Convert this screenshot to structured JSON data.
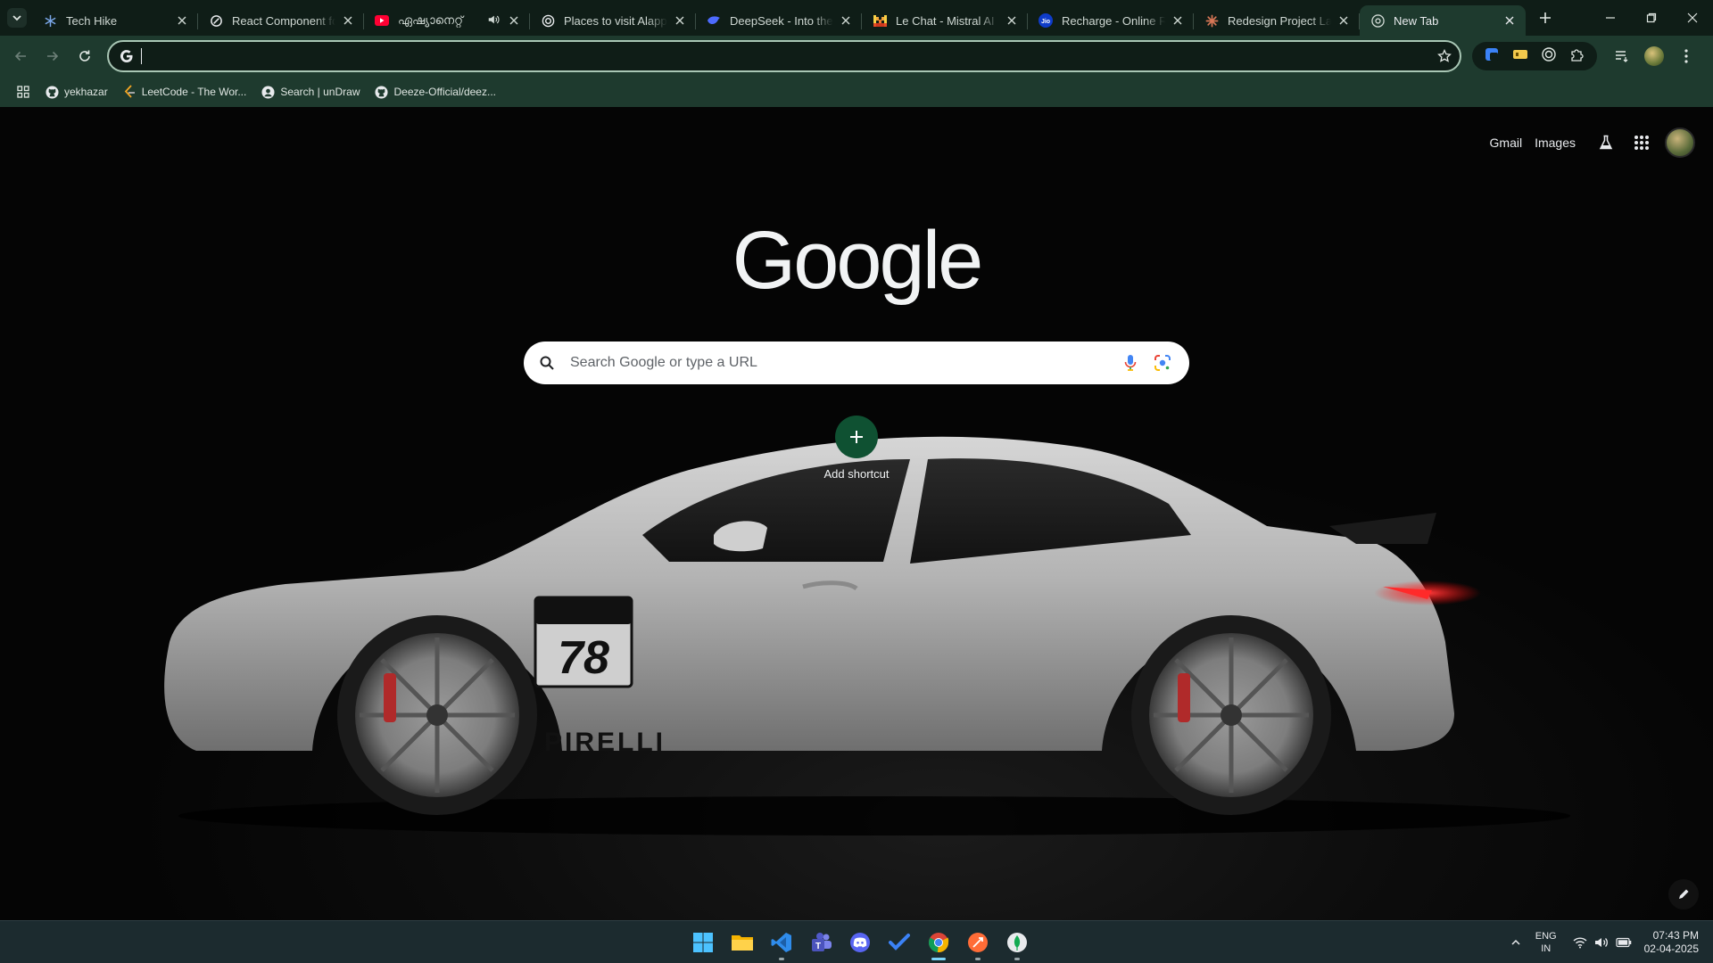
{
  "colors": {
    "accent": "#0f5132",
    "frame": "#1e3a2e",
    "tabstrip": "#0f1d17"
  },
  "tabs": [
    {
      "title": "Tech Hike",
      "icon": "snowflake-icon",
      "audio": false,
      "active": false
    },
    {
      "title": "React Component fo",
      "icon": "openai-icon",
      "audio": false,
      "active": false
    },
    {
      "title": "ഏഷ്യാനെറ്റ്",
      "icon": "youtube-icon",
      "audio": true,
      "active": false
    },
    {
      "title": "Places to visit Alappu",
      "icon": "perplexity-icon",
      "audio": false,
      "active": false
    },
    {
      "title": "DeepSeek - Into the U",
      "icon": "deepseek-icon",
      "audio": false,
      "active": false
    },
    {
      "title": "Le Chat - Mistral AI",
      "icon": "mistral-icon",
      "audio": false,
      "active": false
    },
    {
      "title": "Recharge - Online Re",
      "icon": "jio-icon",
      "audio": false,
      "active": false
    },
    {
      "title": "Redesign Project Lay",
      "icon": "claude-icon",
      "audio": false,
      "active": false
    },
    {
      "title": "New Tab",
      "icon": "chrome-icon",
      "audio": false,
      "active": true
    }
  ],
  "omnibox": {
    "value": "",
    "placeholder": ""
  },
  "bookmarks": [
    {
      "label": "yekhazar",
      "icon": "github-icon"
    },
    {
      "label": "LeetCode - The Wor...",
      "icon": "leetcode-icon"
    },
    {
      "label": "Search | unDraw",
      "icon": "undraw-icon"
    },
    {
      "label": "Deeze-Official/deez...",
      "icon": "github-icon"
    }
  ],
  "ntp": {
    "links": {
      "gmail": "Gmail",
      "images": "Images"
    },
    "logo": "Google",
    "search_placeholder": "Search Google or type a URL",
    "add_shortcut": "Add shortcut"
  },
  "car": {
    "number": "78",
    "sponsor": "PIRELLI"
  },
  "taskbar": {
    "apps": [
      "windows-start-icon",
      "file-explorer-icon",
      "vscode-icon",
      "teams-icon",
      "discord-icon",
      "todo-icon",
      "chrome-icon",
      "postman-icon",
      "mongodb-compass-icon"
    ],
    "lang_top": "ENG",
    "lang_bottom": "IN",
    "time": "07:43 PM",
    "date": "02-04-2025"
  }
}
